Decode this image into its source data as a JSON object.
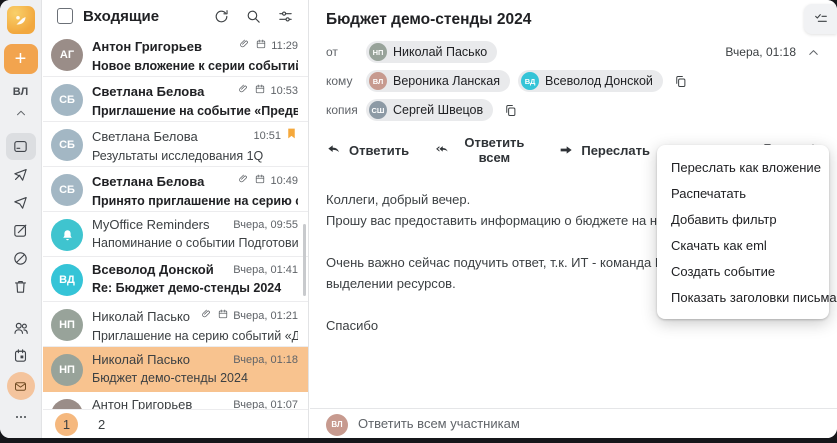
{
  "colors": {
    "accent": "#F2A44E",
    "selected_row": "#F8C38F",
    "teal": "#35C4D7",
    "flag_orange": "#F5A83B"
  },
  "rail": {
    "user_initials": "ВЛ",
    "plus_label": "+"
  },
  "list": {
    "title": "Входящие",
    "items": [
      {
        "sender": "Антон Григорьев",
        "subject": "Новое вложение к серии событий «Аналити...",
        "time": "11:29",
        "initials": "АГ",
        "unread": true,
        "attachment": true,
        "calendar": true
      },
      {
        "sender": "Светлана Белова",
        "subject": "Приглашение на событие «Предварительно...",
        "time": "10:53",
        "initials": "СБ",
        "unread": true,
        "attachment": true,
        "calendar": true
      },
      {
        "sender": "Светлана Белова",
        "subject": "Результаты исследования 1Q",
        "time": "10:51",
        "initials": "СБ",
        "unread": false,
        "flagged": true
      },
      {
        "sender": "Светлана Белова",
        "subject": "Принято приглашение на серию событий «...",
        "time": "10:49",
        "initials": "СБ",
        "unread": true,
        "attachment": true,
        "calendar": true
      },
      {
        "sender": "MyOffice Reminders",
        "subject": "Напоминание о событии Подготовить отчет...",
        "time": "Вчера, 09:55",
        "unread": false
      },
      {
        "sender": "Всеволод Донской",
        "subject": "Re: Бюджет демо-стенды 2024",
        "time": "Вчера, 01:41",
        "initials": "ВД",
        "unread": true
      },
      {
        "sender": "Николай Пасько",
        "subject": "Приглашение на серию событий «Демо стен...",
        "time": "Вчера, 01:21",
        "initials": "НП",
        "unread": false,
        "attachment": true,
        "calendar": true
      },
      {
        "sender": "Николай Пасько",
        "subject": "Бюджет демо-стенды 2024",
        "time": "Вчера, 01:18",
        "initials": "НП",
        "unread": false,
        "selected": true
      },
      {
        "sender": "Антон Григорьев",
        "subject": "",
        "time": "Вчера, 01:07",
        "initials": "АГ",
        "unread": false
      }
    ],
    "pagination": {
      "current": "1",
      "next": "2"
    }
  },
  "reader": {
    "subject": "Бюджет демо-стенды 2024",
    "from_label": "от",
    "from": "Николай Пасько",
    "from_initials": "НП",
    "to_label": "кому",
    "to1": "Вероника Ланская",
    "to1_initials": "ВЛ",
    "to2": "Всеволод Донской",
    "to2_initials": "ВД",
    "cc_label": "копия",
    "cc1": "Сергей Швецов",
    "cc1_initials": "СШ",
    "date": "Вчера, 01:18",
    "actions": {
      "reply": "Ответить",
      "reply_all": "Ответить всем",
      "forward": "Переслать"
    },
    "body": [
      "Коллеги, добрый вечер.",
      "Прошу вас предоставить информацию о бюджете на наши демонстраци",
      "",
      "Очень важно сейчас подучить ответ, т.к. ИТ - команда Всеволода, уже",
      "выделении ресурсов.",
      "",
      "Спасибо"
    ],
    "reply_bar": "Ответить всем участникам",
    "reply_avatar_initials": "ВЛ"
  },
  "menu": {
    "items": [
      "Переслать как вложение",
      "Распечатать",
      "Добавить фильтр",
      "Скачать как eml",
      "Создать событие",
      "Показать заголовки письма"
    ]
  }
}
